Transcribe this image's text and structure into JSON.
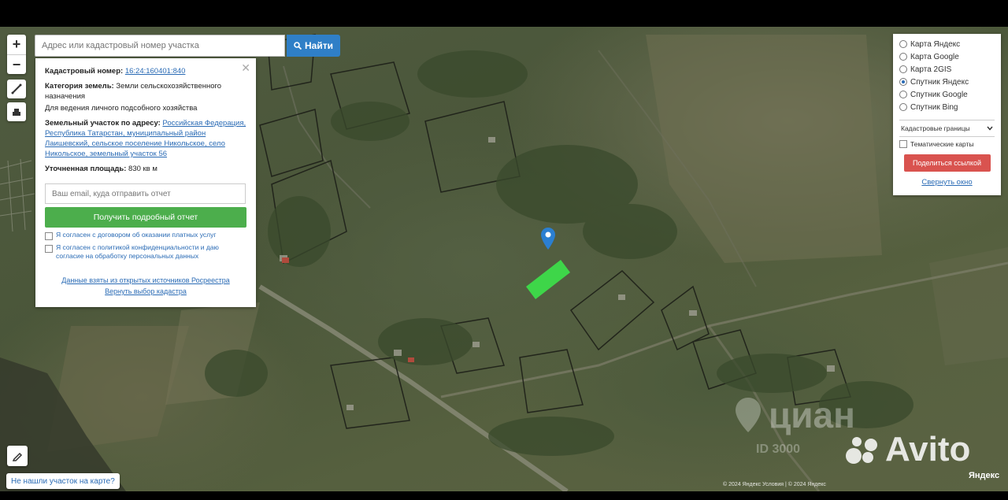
{
  "search": {
    "placeholder": "Адрес или кадастровый номер участка",
    "button_label": "Найти"
  },
  "zoom": {
    "in_label": "+",
    "out_label": "−"
  },
  "info": {
    "cadastral_label": "Кадастровый номер:",
    "cadastral_value": "16:24:160401:840",
    "category_label": "Категория земель:",
    "category_value": "Земли сельскохозяйственного назначения",
    "usage_value": "Для ведения личного подсобного хозяйства",
    "address_label": "Земельный участок по адресу:",
    "address_value": "Российская Федерация, Республика Татарстан, муниципальный район Лаишевский, сельское поселение Никольское, село Никольское, земельный участок 56",
    "area_label": "Уточненная площадь:",
    "area_value": "830 кв м",
    "email_placeholder": "Ваш email, куда отправить отчет",
    "report_button": "Получить подробный отчет",
    "consent_1": "Я согласен с договором об оказании платных услуг",
    "consent_2": "Я согласен с политикой конфиденциальности и даю согласие на обработку персональных данных",
    "link_1": "Данные взяты из открытых источников Росреестра",
    "link_2": "Вернуть выбор кадастра"
  },
  "layers": {
    "options": [
      "Карта Яндекс",
      "Карта Google",
      "Карта 2GIS",
      "Спутник Яндекс",
      "Спутник Google",
      "Спутник Bing"
    ],
    "selected_index": 3,
    "select_value": "Кадастровые границы",
    "checkbox_label": "Тематические карты",
    "share_button": "Поделиться ссылкой",
    "collapse_link": "Свернуть окно"
  },
  "bottom_link": "Не нашли участок на карте?",
  "watermark_cian": "циан",
  "watermark_cian_id": "ID 3000",
  "watermark_avito": "Avito",
  "copyright": "© 2024 Яндекс Условия | © 2024 Яндекс",
  "yandex_logo": "Яндекс",
  "colors": {
    "plot": "#3ddc4a",
    "pin": "#2b7fd1",
    "report_button": "#4cae4c",
    "share_button": "#d9534f",
    "search_button": "#2f7fc7"
  }
}
